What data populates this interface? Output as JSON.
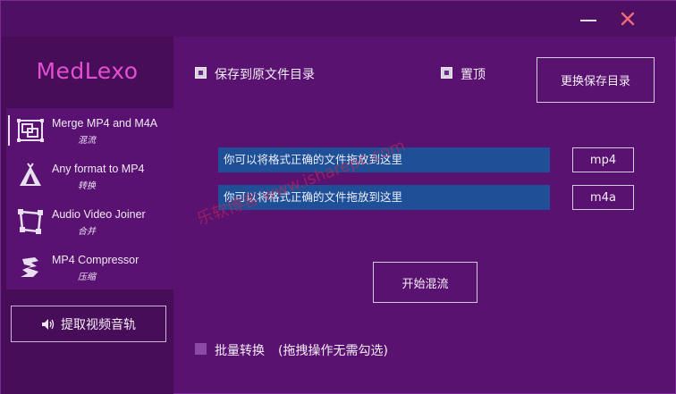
{
  "window": {
    "minimize_icon": "minimize-icon",
    "close_icon": "close-icon",
    "close_color": "#f06a7a"
  },
  "brand": {
    "name": "MedLexo",
    "color": "#e24fd0"
  },
  "sidebar": {
    "items": [
      {
        "title": "Merge MP4 and M4A",
        "subtitle": "混流",
        "icon": "merge-icon",
        "active": true
      },
      {
        "title": "Any format to MP4",
        "subtitle": "转换",
        "icon": "convert-icon",
        "active": false
      },
      {
        "title": "Audio Video Joiner",
        "subtitle": "合并",
        "icon": "joiner-icon",
        "active": false
      },
      {
        "title": "MP4 Compressor",
        "subtitle": "压缩",
        "icon": "compressor-icon",
        "active": false
      }
    ],
    "extract_button": {
      "label": "提取视频音轨",
      "icon": "speaker-icon"
    }
  },
  "main": {
    "save_to_source": {
      "label": "保存到原文件目录",
      "checked": true
    },
    "pin_top": {
      "label": "置顶",
      "checked": true
    },
    "change_dir_button": "更换保存目录",
    "drop_fields": [
      {
        "placeholder": "你可以将格式正确的文件拖放到这里",
        "button": "mp4"
      },
      {
        "placeholder": "你可以将格式正确的文件拖放到这里",
        "button": "m4a"
      }
    ],
    "start_button": "开始混流",
    "batch": {
      "label": "批量转换",
      "note": "(拖拽操作无需勾选)",
      "checked": false
    }
  },
  "watermark": "乐软博客 www.isharepc.com",
  "colors": {
    "background": "#5a1270",
    "sidebar": "#470d58",
    "drop_field": "#1f4f96"
  }
}
